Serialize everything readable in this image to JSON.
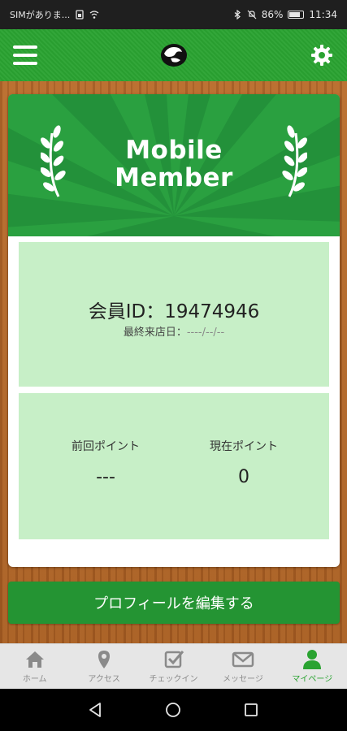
{
  "status_bar": {
    "carrier": "SIMがありま...",
    "battery": "86%",
    "time": "11:34"
  },
  "header": {
    "menu_icon": "hamburger-menu-icon",
    "logo_icon": "brand-logo-icon",
    "settings_icon": "gear-icon"
  },
  "hero": {
    "title_line1": "Mobile",
    "title_line2": "Member"
  },
  "member": {
    "id_label": "会員ID：19474946",
    "last_visit_label": "最終来店日：",
    "last_visit_value": "----/--/--"
  },
  "points": {
    "previous_label": "前回ポイント",
    "previous_value": "---",
    "current_label": "現在ポイント",
    "current_value": "0"
  },
  "edit_profile_label": "プロフィールを編集する",
  "bottom_nav": [
    {
      "label": "ホーム",
      "icon": "home-icon",
      "active": false
    },
    {
      "label": "アクセス",
      "icon": "map-pin-icon",
      "active": false
    },
    {
      "label": "チェックイン",
      "icon": "checkbox-icon",
      "active": false
    },
    {
      "label": "メッセージ",
      "icon": "mail-icon",
      "active": false
    },
    {
      "label": "マイページ",
      "icon": "user-icon",
      "active": true
    }
  ],
  "colors": {
    "header_green": "#2aa331",
    "panel_green": "#c7efc7",
    "button_green": "#249433",
    "active_nav": "#2aa331"
  }
}
